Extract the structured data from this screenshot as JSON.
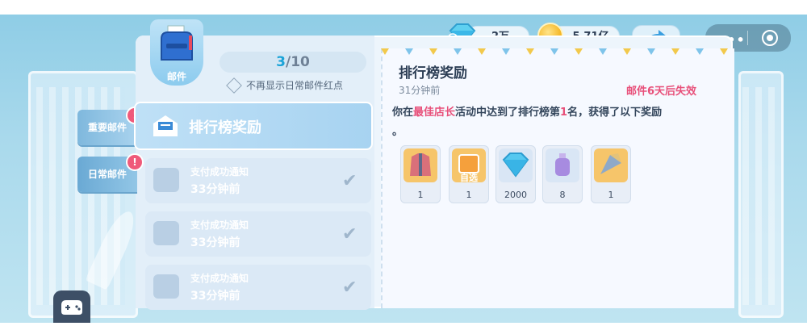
{
  "topbar": {
    "diamonds": "2万",
    "coins": "5.71亿"
  },
  "mailbox": {
    "icon_label": "邮件",
    "counter_current": "3",
    "counter_total": "/10",
    "hide_dot_option": "不再显示日常邮件红点"
  },
  "side_tabs": [
    {
      "label": "重要邮件",
      "alert": "!"
    },
    {
      "label": "日常邮件",
      "alert": "!"
    }
  ],
  "mails": [
    {
      "title": "排行榜奖励",
      "selected": true
    },
    {
      "title": "支付成功通知",
      "time": "33分钟前"
    },
    {
      "title": "支付成功通知",
      "time": "33分钟前"
    },
    {
      "title": "支付成功通知",
      "time": "33分钟前"
    }
  ],
  "detail": {
    "title": "排行榜奖励",
    "time": "31分钟前",
    "expire": "邮件6天后失效",
    "body_prefix": "你在",
    "body_highlight": "最佳店长",
    "body_mid": "活动中达到了排行榜第",
    "body_rank": "1",
    "body_suffix": "名，获得了以下奖励",
    "body_end": "。",
    "rewards": [
      {
        "icon": "jacket-icon",
        "count": "1"
      },
      {
        "icon": "optional-box-icon",
        "label": "自选",
        "count": "1"
      },
      {
        "icon": "diamond-icon",
        "count": "2000"
      },
      {
        "icon": "potion-bottle-icon",
        "count": "8"
      },
      {
        "icon": "fan-decoration-icon",
        "count": "1"
      }
    ]
  },
  "colors": {
    "highlight": "#e8507a",
    "rank": "#e8507a",
    "expire": "#e8507a"
  }
}
